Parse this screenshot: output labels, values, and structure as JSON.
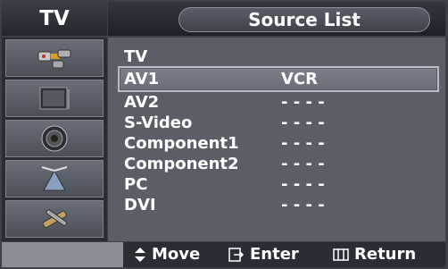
{
  "header": {
    "mode_label": "TV",
    "title": "Source List"
  },
  "sidebar": {
    "items": [
      {
        "icon": "input-plug-icon"
      },
      {
        "icon": "picture-icon"
      },
      {
        "icon": "sound-speaker-icon"
      },
      {
        "icon": "channel-antenna-icon"
      },
      {
        "icon": "setup-tools-icon"
      }
    ]
  },
  "sources": [
    {
      "name": "TV",
      "value": ""
    },
    {
      "name": "AV1",
      "value": "VCR",
      "selected": true
    },
    {
      "name": "AV2",
      "value": "- - - -"
    },
    {
      "name": "S-Video",
      "value": "- - - -"
    },
    {
      "name": "Component1",
      "value": "- - - -"
    },
    {
      "name": "Component2",
      "value": "- - - -"
    },
    {
      "name": "PC",
      "value": "- - - -"
    },
    {
      "name": "DVI",
      "value": "- - - -"
    }
  ],
  "footer": {
    "move_label": "Move",
    "enter_label": "Enter",
    "return_label": "Return"
  }
}
